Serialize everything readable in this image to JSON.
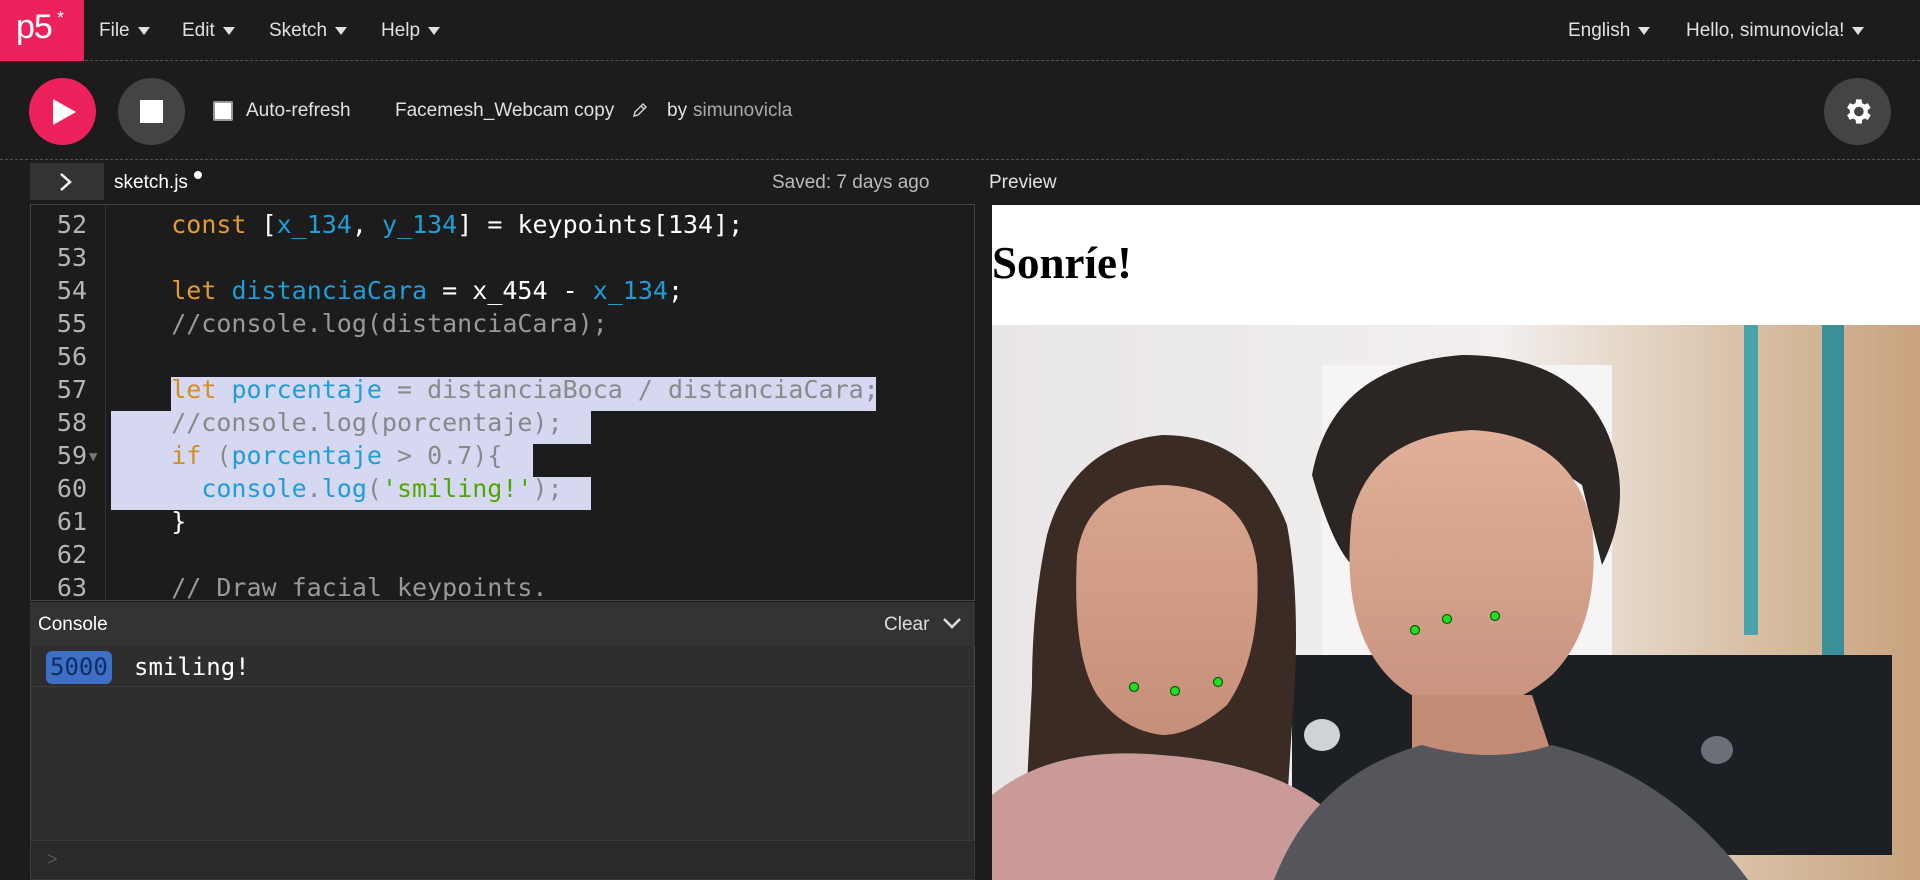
{
  "nav": {
    "logo_text": "p5",
    "logo_mark": "*",
    "menus": [
      "File",
      "Edit",
      "Sketch",
      "Help"
    ],
    "language": "English",
    "user_greeting": "Hello, simunovicla!"
  },
  "toolbar": {
    "auto_refresh_label": "Auto-refresh",
    "auto_refresh_checked": false,
    "sketch_name": "Facemesh_Webcam copy",
    "by_label": "by",
    "author": "simunovicla"
  },
  "editor": {
    "file_name": "sketch.js",
    "saved_status": "Saved: 7 days ago",
    "line_numbers": [
      "52",
      "53",
      "54",
      "55",
      "56",
      "57",
      "58",
      "59",
      "60",
      "61",
      "62",
      "63"
    ],
    "code_lines": [
      "    const [x_134, y_134] = keypoints[134];",
      "",
      "    let distanciaCara = x_454 - x_134;",
      "    //console.log(distanciaCara);",
      "",
      "    let porcentaje = distanciaBoca / distanciaCara;",
      "    //console.log(porcentaje);",
      "    if (porcentaje > 0.7){",
      "      console.log('smiling!');",
      "    }",
      "",
      "    // Draw facial keypoints."
    ]
  },
  "preview": {
    "label": "Preview",
    "heading": "Sonríe!"
  },
  "console": {
    "title": "Console",
    "clear_label": "Clear",
    "count": "5000",
    "message": "smiling!",
    "prompt": ">"
  },
  "colors": {
    "brand": "#ed225d",
    "background": "#1c1c1c",
    "selection": "#d6d8f2",
    "keypoint": "#22dd22"
  }
}
